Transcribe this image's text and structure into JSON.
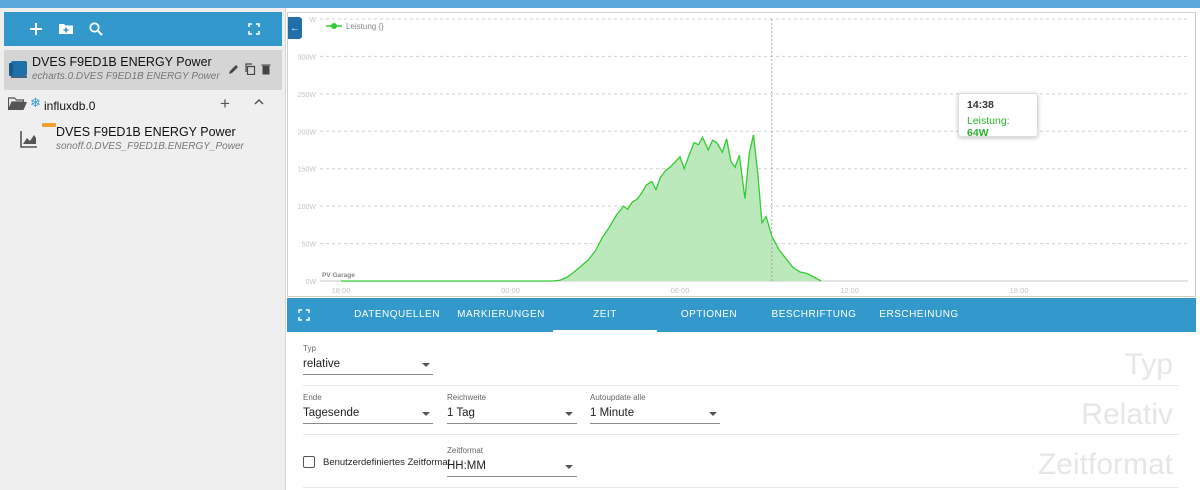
{
  "sidebar": {
    "chart_item": {
      "title": "DVES F9ED1B ENERGY Power",
      "subtitle": "echarts.0.DVES F9ED1B ENERGY Power"
    },
    "folder": {
      "label": "influxdb.0"
    },
    "datasource_item": {
      "title": "DVES F9ED1B ENERGY Power",
      "subtitle": "sonoff.0.DVES_F9ED1B.ENERGY_Power"
    }
  },
  "chart_data": {
    "type": "area",
    "legend": "Leistung {}",
    "series_name": "Leistung",
    "marker_label": "PV Garage",
    "y_ticks": [
      "0W",
      "50W",
      "100W",
      "150W",
      "200W",
      "250W",
      "300W",
      "W"
    ],
    "y_max": 350,
    "x_ticks": [
      "18:00",
      "00:00",
      "06:00",
      "12:00",
      "18:00"
    ],
    "grid": true,
    "points": [
      [
        0,
        0
      ],
      [
        1,
        0
      ],
      [
        2,
        0
      ],
      [
        3,
        0
      ],
      [
        4,
        0
      ],
      [
        5,
        0
      ],
      [
        6,
        0
      ],
      [
        7,
        0
      ],
      [
        8,
        0
      ],
      [
        9,
        0
      ],
      [
        10,
        0
      ],
      [
        11,
        0
      ],
      [
        12,
        0
      ],
      [
        13,
        0
      ],
      [
        14,
        0
      ],
      [
        15,
        0
      ],
      [
        15.5,
        1
      ],
      [
        16,
        5
      ],
      [
        16.5,
        12
      ],
      [
        17,
        20
      ],
      [
        17.5,
        28
      ],
      [
        18,
        40
      ],
      [
        18.5,
        58
      ],
      [
        19,
        72
      ],
      [
        19.5,
        88
      ],
      [
        20,
        100
      ],
      [
        20.3,
        96
      ],
      [
        20.6,
        105
      ],
      [
        21,
        110
      ],
      [
        21.3,
        118
      ],
      [
        21.6,
        128
      ],
      [
        22,
        133
      ],
      [
        22.3,
        122
      ],
      [
        22.6,
        138
      ],
      [
        23,
        148
      ],
      [
        23.3,
        152
      ],
      [
        23.6,
        158
      ],
      [
        24,
        166
      ],
      [
        24.3,
        150
      ],
      [
        24.6,
        166
      ],
      [
        25,
        185
      ],
      [
        25.3,
        182
      ],
      [
        25.6,
        192
      ],
      [
        26,
        175
      ],
      [
        26.3,
        188
      ],
      [
        26.6,
        185
      ],
      [
        27,
        172
      ],
      [
        27.3,
        190
      ],
      [
        27.6,
        160
      ],
      [
        27.9,
        152
      ],
      [
        28.2,
        168
      ],
      [
        28.6,
        110
      ],
      [
        28.9,
        170
      ],
      [
        29.2,
        195
      ],
      [
        29.5,
        145
      ],
      [
        29.8,
        78
      ],
      [
        30.1,
        86
      ],
      [
        30.5,
        60
      ],
      [
        31,
        42
      ],
      [
        31.5,
        30
      ],
      [
        32,
        18
      ],
      [
        32.5,
        12
      ],
      [
        33,
        10
      ],
      [
        33.5,
        5
      ],
      [
        34,
        0
      ]
    ],
    "x_range": [
      0,
      48
    ],
    "crosshair_x": 30.5
  },
  "tooltip": {
    "time": "14:38",
    "label": "Leistung:",
    "value": "64W"
  },
  "tabs": [
    "DATENQUELLEN",
    "MARKIERUNGEN",
    "ZEIT",
    "OPTIONEN",
    "BESCHRIFTUNG",
    "ERSCHEINUNG"
  ],
  "form": {
    "typ_label": "Typ",
    "typ_value": "relative",
    "ende_label": "Ende",
    "ende_value": "Tagesende",
    "reichweite_label": "Reichweite",
    "reichweite_value": "1 Tag",
    "autoupdate_label": "Autoupdate alle",
    "autoupdate_value": "1 Minute",
    "custom_format_label": "Benutzerdefiniertes Zeitformat",
    "zeitformat_label": "Zeitformat",
    "zeitformat_value": "HH:MM",
    "section_typ": "Typ",
    "section_relativ": "Relativ",
    "section_zeitformat": "Zeitformat"
  },
  "colors": {
    "accent": "#3399cc",
    "series": "#33cc33",
    "fill": "#b4e7b4"
  }
}
